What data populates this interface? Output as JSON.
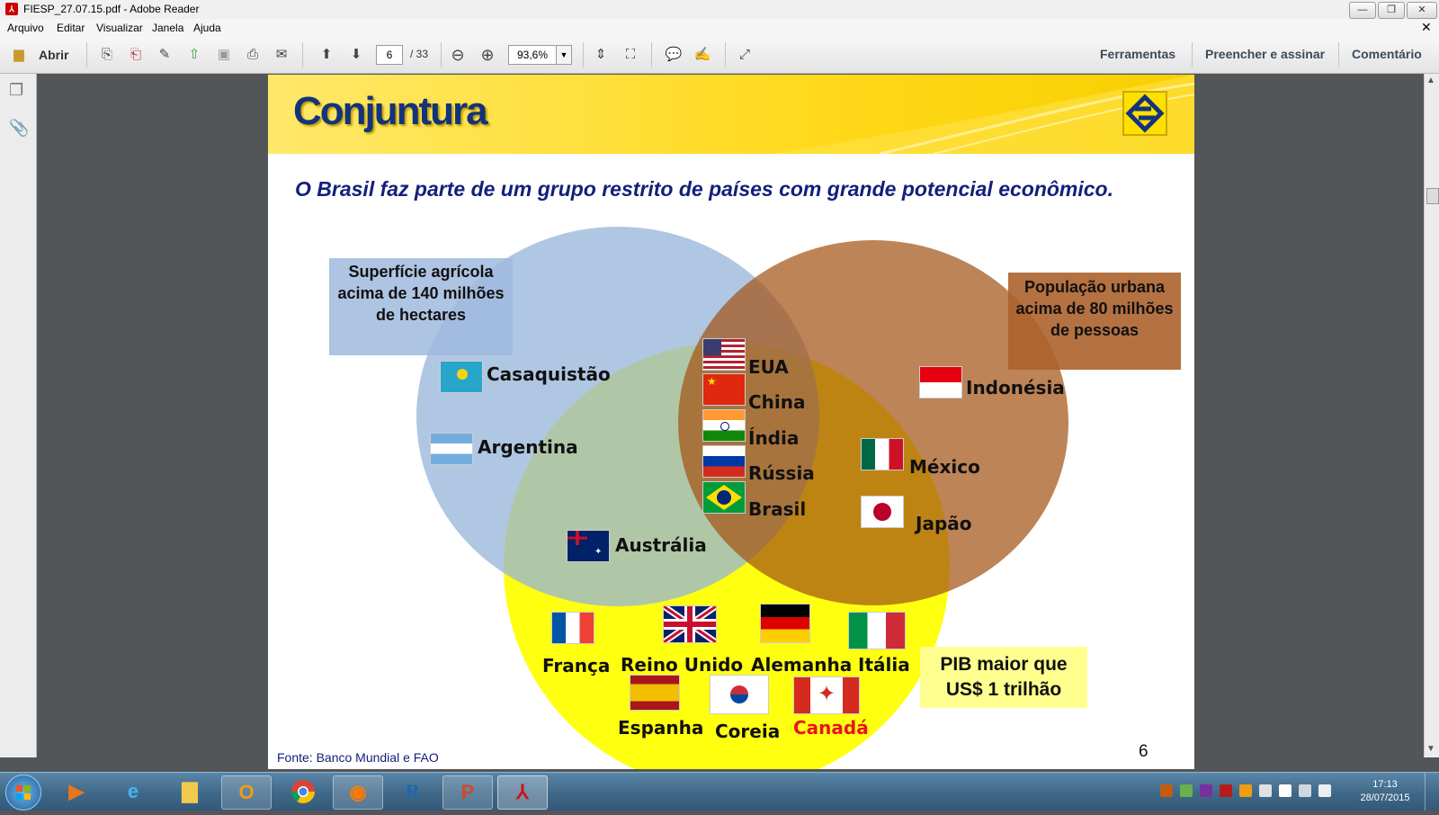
{
  "window": {
    "title": "FIESP_27.07.15.pdf - Adobe Reader",
    "controls": [
      "—",
      "❐",
      "✕"
    ]
  },
  "menu": [
    "Arquivo",
    "Editar",
    "Visualizar",
    "Janela",
    "Ajuda"
  ],
  "toolbar": {
    "open_label": "Abrir",
    "page_current": "6",
    "page_total": "/ 33",
    "zoom": "93,6%",
    "right_links": [
      "Ferramentas",
      "Preencher e assinar",
      "Comentário"
    ]
  },
  "slide": {
    "title": "Conjuntura",
    "subtitle": "O Brasil faz parte de um grupo restrito de países com grande potencial econômico.",
    "label_agri": "Superfície agrícola acima de 140 milhões de hectares",
    "label_urban": "População urbana acima de 80 milhões de pessoas",
    "label_gdp": "PIB maior que US$ 1 trilhão",
    "countries": {
      "kazakhstan": "Casaquistão",
      "argentina": "Argentina",
      "australia": "Austrália",
      "usa": "EUA",
      "china": "China",
      "india": "Índia",
      "russia": "Rússia",
      "brazil": "Brasil",
      "indonesia": "Indonésia",
      "mexico": "México",
      "japan": "Japão",
      "france": "França",
      "uk": "Reino Unido",
      "germany": "Alemanha",
      "italy": "Itália",
      "spain": "Espanha",
      "korea": "Coreia",
      "canada": "Canadá"
    },
    "source": "Fonte: Banco Mundial e FAO",
    "page_number": "6",
    "colors": {
      "title": "#13337c",
      "agri_circle": "#9bb8dc",
      "urban_circle": "#a85a1e",
      "gdp_circle": "#ffff10",
      "canada_text": "#e8151f"
    }
  },
  "taskbar": {
    "clock_time": "17:13",
    "clock_date": "28/07/2015"
  }
}
